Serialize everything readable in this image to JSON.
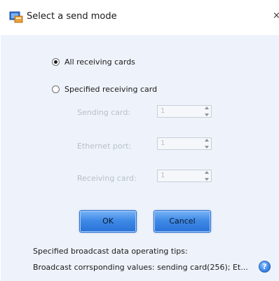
{
  "window": {
    "title": "Select a send mode",
    "close_glyph": "×",
    "icon": "app-icon"
  },
  "mode": {
    "options": [
      {
        "label": "All receiving cards",
        "checked": true
      },
      {
        "label": "Specified receiving card",
        "checked": false
      }
    ]
  },
  "fields": {
    "sending_card": {
      "label": "Sending card:",
      "value": "1"
    },
    "ethernet_port": {
      "label": "Ethernet port:",
      "value": "1"
    },
    "receiving_card": {
      "label": "Receiving card:",
      "value": "1"
    }
  },
  "buttons": {
    "ok_label": "OK",
    "cancel_label": "Cancel"
  },
  "tips": {
    "heading": "Specified broadcast data operating tips:",
    "detail": "Broadcast corrsponding values: sending card(256); Et..."
  },
  "help_icon_glyph": "?",
  "colors": {
    "client_bg": "#eef3fb",
    "button_blue": "#3f8ae6",
    "disabled_text": "#b8bfc9"
  }
}
